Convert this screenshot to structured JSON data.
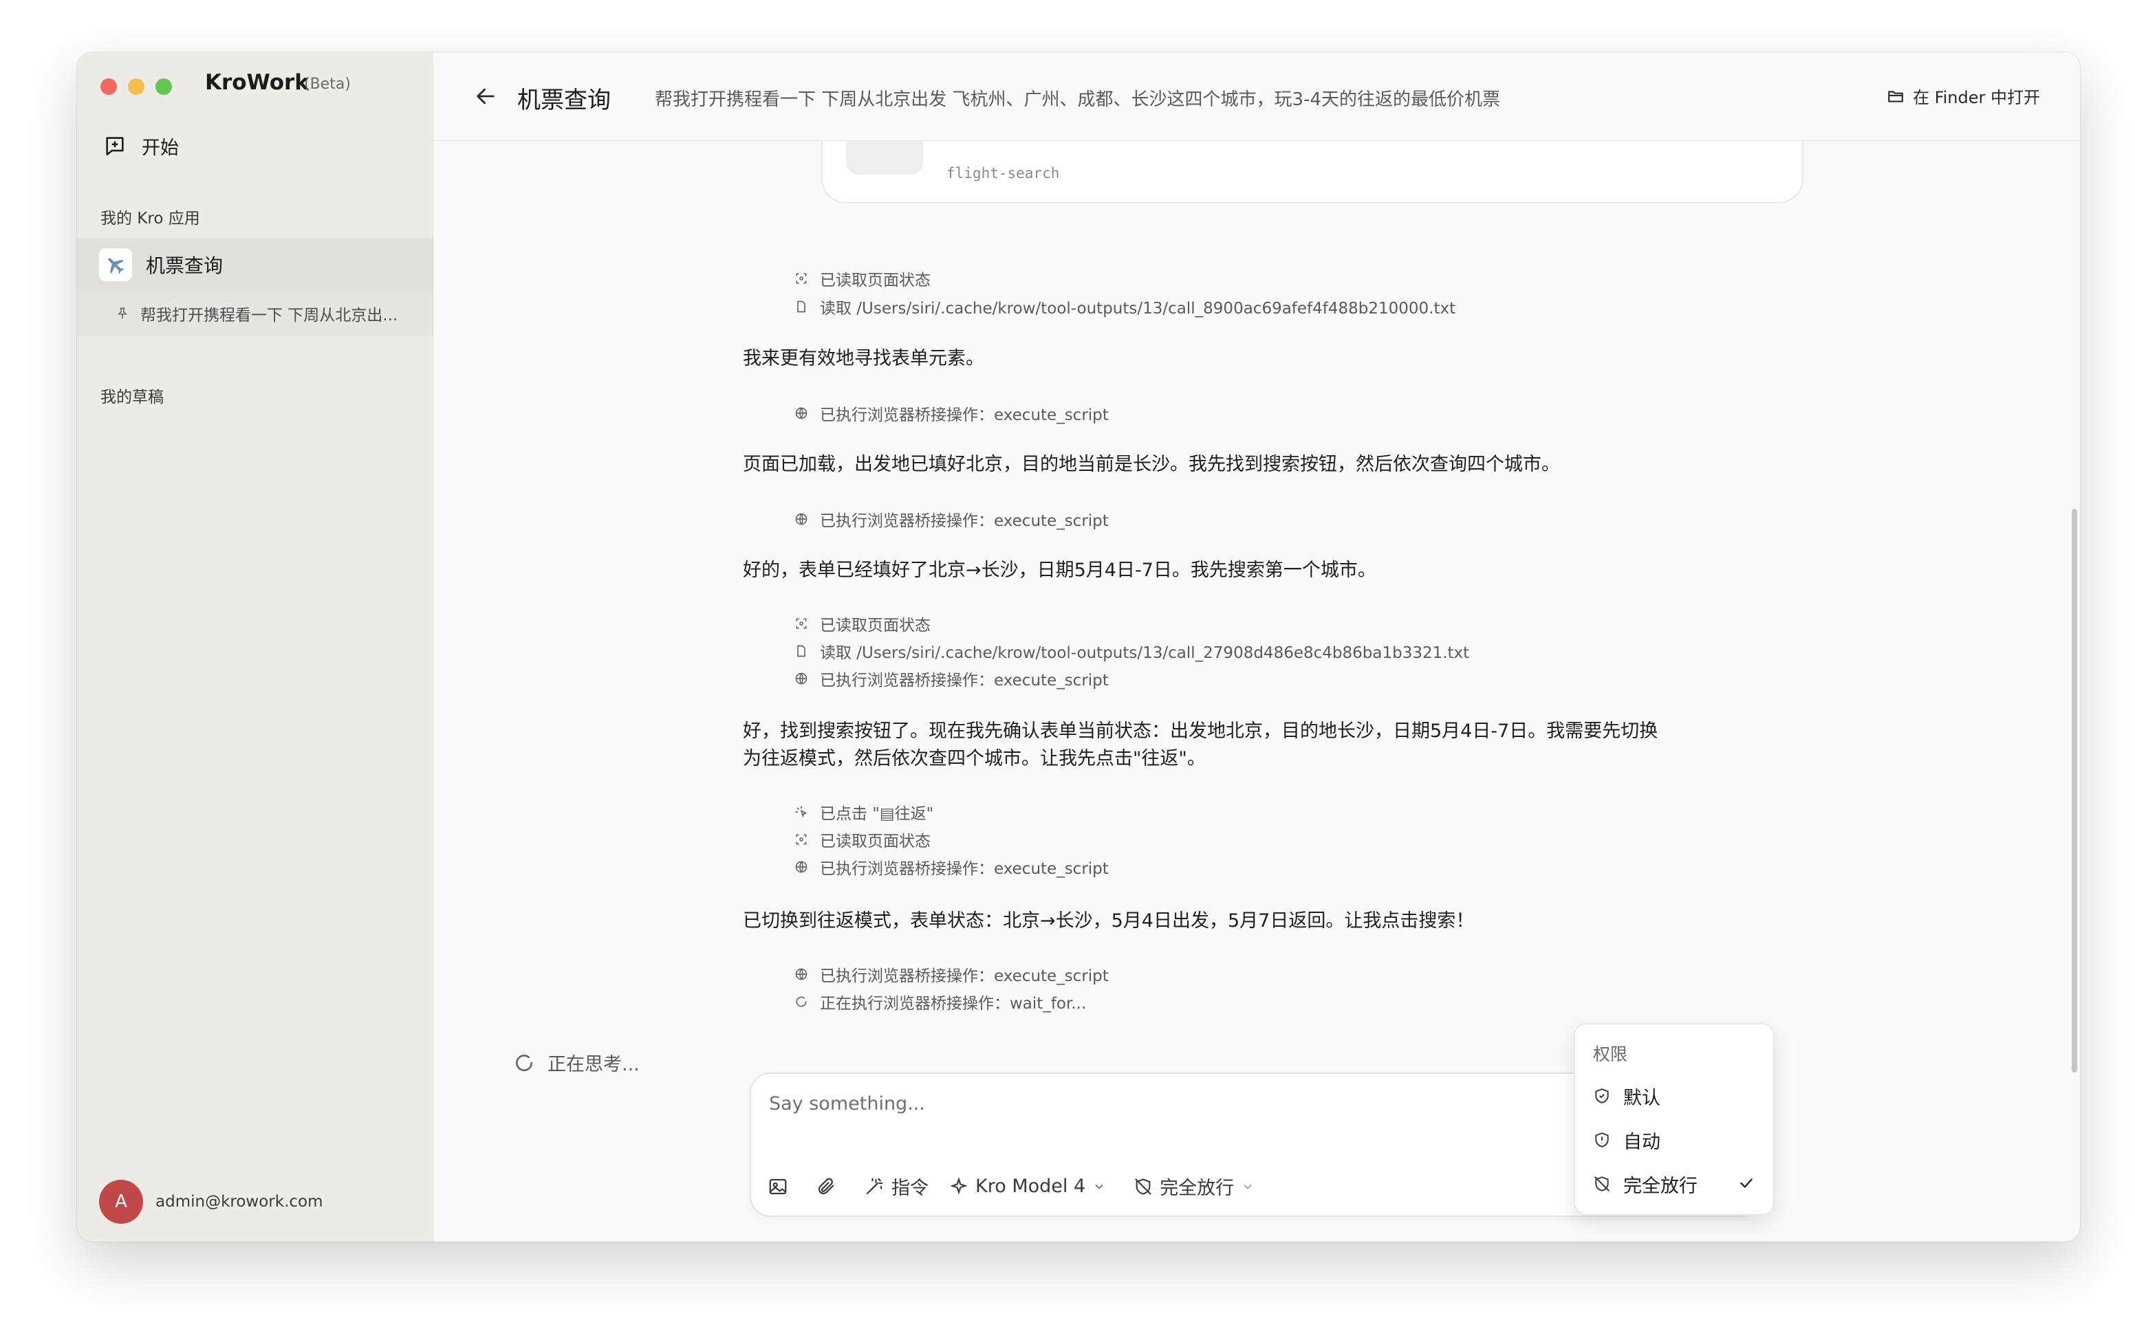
{
  "app": {
    "name": "KroWork",
    "badge": "(Beta)"
  },
  "sidebar": {
    "start_label": "开始",
    "apps_section": "我的 Kro 应用",
    "active_app": "机票查询",
    "pinned_task": "帮我打开携程看一下 下周从北京出...",
    "drafts_section": "我的草稿",
    "user": {
      "initial": "A",
      "email": "admin@krowork.com"
    }
  },
  "header": {
    "title": "机票查询",
    "subtitle": "帮我打开携程看一下 下周从北京出发 飞杭州、广州、成都、长沙这四个城市，玩3-4天的往返的最低价机票",
    "finder_button": "在 Finder 中打开"
  },
  "skill_card": {
    "name": "flight-search"
  },
  "timeline": {
    "t1": {
      "text": "已读取页面状态",
      "icon": "scan-icon"
    },
    "t2": {
      "text": "读取 /Users/siri/.cache/krow/tool-outputs/13/call_8900ac69afef4f488b210000.txt",
      "icon": "file-icon"
    },
    "m1": "我来更有效地寻找表单元素。",
    "t3": {
      "text": "已执行浏览器桥接操作：execute_script",
      "icon": "globe-icon"
    },
    "m2": "页面已加载，出发地已填好北京，目的地当前是长沙。我先找到搜索按钮，然后依次查询四个城市。",
    "t4": {
      "text": "已执行浏览器桥接操作：execute_script",
      "icon": "globe-icon"
    },
    "m3": "好的，表单已经填好了北京→长沙，日期5月4日-7日。我先搜索第一个城市。",
    "t5": {
      "text": "已读取页面状态",
      "icon": "scan-icon"
    },
    "t6": {
      "text": "读取 /Users/siri/.cache/krow/tool-outputs/13/call_27908d486e8c4b86ba1b3321.txt",
      "icon": "file-icon"
    },
    "t7": {
      "text": "已执行浏览器桥接操作：execute_script",
      "icon": "globe-icon"
    },
    "m4_line1": "好，找到搜索按钮了。现在我先确认表单当前状态：出发地北京，目的地长沙，日期5月4日-7日。我需要先切换",
    "m4_line2": "为往返模式，然后依次查四个城市。让我先点击\"往返\"。",
    "t8": {
      "text": "已点击 \"▤往返\"",
      "icon": "click-icon"
    },
    "t9": {
      "text": "已读取页面状态",
      "icon": "scan-icon"
    },
    "t10": {
      "text": "已执行浏览器桥接操作：execute_script",
      "icon": "globe-icon"
    },
    "m5": "已切换到往返模式，表单状态：北京→长沙，5月4日出发，5月7日返回。让我点击搜索！",
    "t11": {
      "text": "已执行浏览器桥接操作：execute_script",
      "icon": "globe-icon"
    },
    "t12": {
      "text": "正在执行浏览器桥接操作：wait_for...",
      "icon": "spinner-icon"
    }
  },
  "thinking": "正在思考...",
  "composer": {
    "placeholder": "Say something...",
    "command_label": "指令",
    "model_label": "Kro Model 4",
    "permission_label": "完全放行"
  },
  "permission_menu": {
    "title": "权限",
    "options": [
      "默认",
      "自动",
      "完全放行"
    ],
    "selected": "完全放行"
  },
  "colors": {
    "avatar": "#c14848",
    "accent_dark": "#1c1c1c",
    "sidebar_bg": "#efebe6",
    "main_bg": "#fbfaf8"
  }
}
